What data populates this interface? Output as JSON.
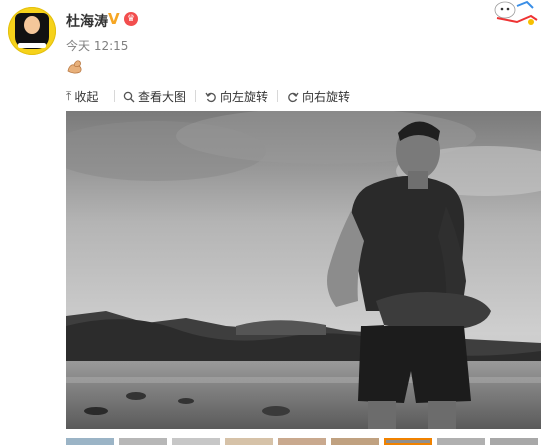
{
  "post": {
    "username": "杜海涛",
    "timestamp": "今天 12:15",
    "emoji": "flexed-biceps-icon"
  },
  "toolbar": {
    "collapse_label": "收起",
    "view_large_label": "查看大图",
    "rotate_left_label": "向左旋转",
    "rotate_right_label": "向右旋转"
  },
  "colors": {
    "accent": "#f08200",
    "verified": "#f6a623",
    "text": "#333333",
    "muted": "#808080"
  }
}
